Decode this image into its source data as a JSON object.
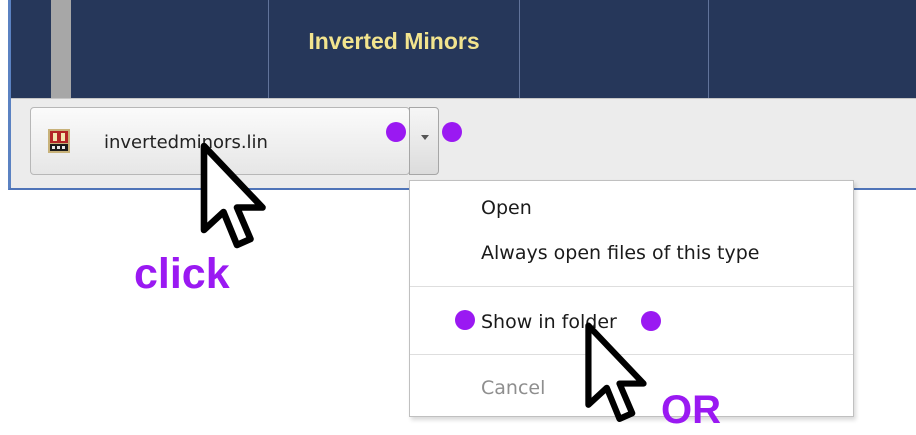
{
  "page": {
    "heading": "Inverted Minors"
  },
  "download": {
    "file_name": "invertedminors.lin",
    "file_icon": "lin-file-icon",
    "menu_button_icon": "chevron-down-icon"
  },
  "context_menu": {
    "items": [
      {
        "label": "Open"
      },
      {
        "label": "Always open files of this type"
      },
      {
        "label": "Show in folder"
      },
      {
        "label": "Cancel",
        "disabled": true
      }
    ]
  },
  "annotations": {
    "click_label": "click",
    "or_label": "OR",
    "marker_color": "#9a19f2"
  }
}
